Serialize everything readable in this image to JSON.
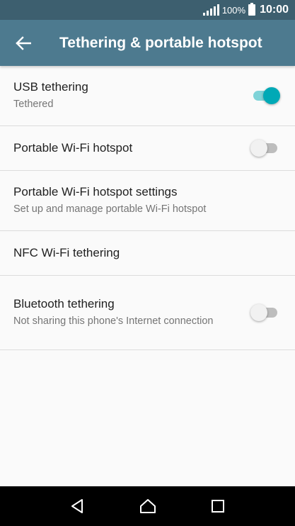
{
  "status_bar": {
    "battery_percent": "100%",
    "time": "10:00"
  },
  "app_bar": {
    "title": "Tethering & portable hotspot"
  },
  "settings": {
    "items": [
      {
        "title": "USB tethering",
        "subtitle": "Tethered",
        "toggle": true
      },
      {
        "title": "Portable Wi-Fi hotspot",
        "toggle": false
      },
      {
        "title": "Portable Wi-Fi hotspot settings",
        "subtitle": "Set up and manage portable Wi-Fi hotspot"
      },
      {
        "title": "NFC Wi-Fi tethering"
      },
      {
        "title": "Bluetooth tethering",
        "subtitle": "Not sharing this phone's Internet connection",
        "toggle": false
      }
    ]
  },
  "colors": {
    "status_bar": "#3d5f6f",
    "app_bar": "#4d7a8f",
    "accent": "#00a9b6"
  },
  "icons": {
    "back": "arrow-left-icon",
    "nav_back": "triangle-back-icon",
    "nav_home": "home-icon",
    "nav_recents": "square-recents-icon"
  }
}
